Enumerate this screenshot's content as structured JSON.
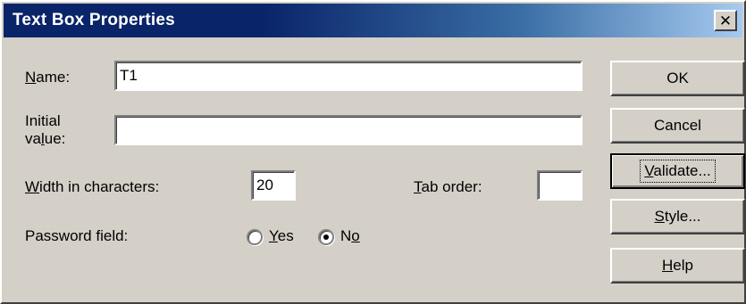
{
  "window": {
    "title": "Text Box Properties",
    "close_symbol": "✕"
  },
  "fields": {
    "name_label_first": "N",
    "name_label_rest": "ame:",
    "name_value": "T1",
    "initial_label_line1": "Initial",
    "initial_label_line2_pre": "va",
    "initial_label_line2_ul": "l",
    "initial_label_line2_post": "ue:",
    "initial_value": "",
    "width_label_ul": "W",
    "width_label_rest": "idth in characters:",
    "width_value": "20",
    "tab_label_ul": "T",
    "tab_label_rest": "ab order:",
    "tab_value": "",
    "password_label": "Password field:"
  },
  "password_options": {
    "yes_ul": "Y",
    "yes_rest": "es",
    "no_pre": "N",
    "no_ul": "o",
    "selected": "No"
  },
  "buttons": {
    "ok": "OK",
    "cancel": "Cancel",
    "validate_ul": "V",
    "validate_rest": "alidate...",
    "style_ul": "S",
    "style_rest": "tyle...",
    "help_ul": "H",
    "help_rest": "elp"
  },
  "colors": {
    "title_start": "#0a246a",
    "title_end": "#a6caf0",
    "face": "#d4d0c8"
  }
}
